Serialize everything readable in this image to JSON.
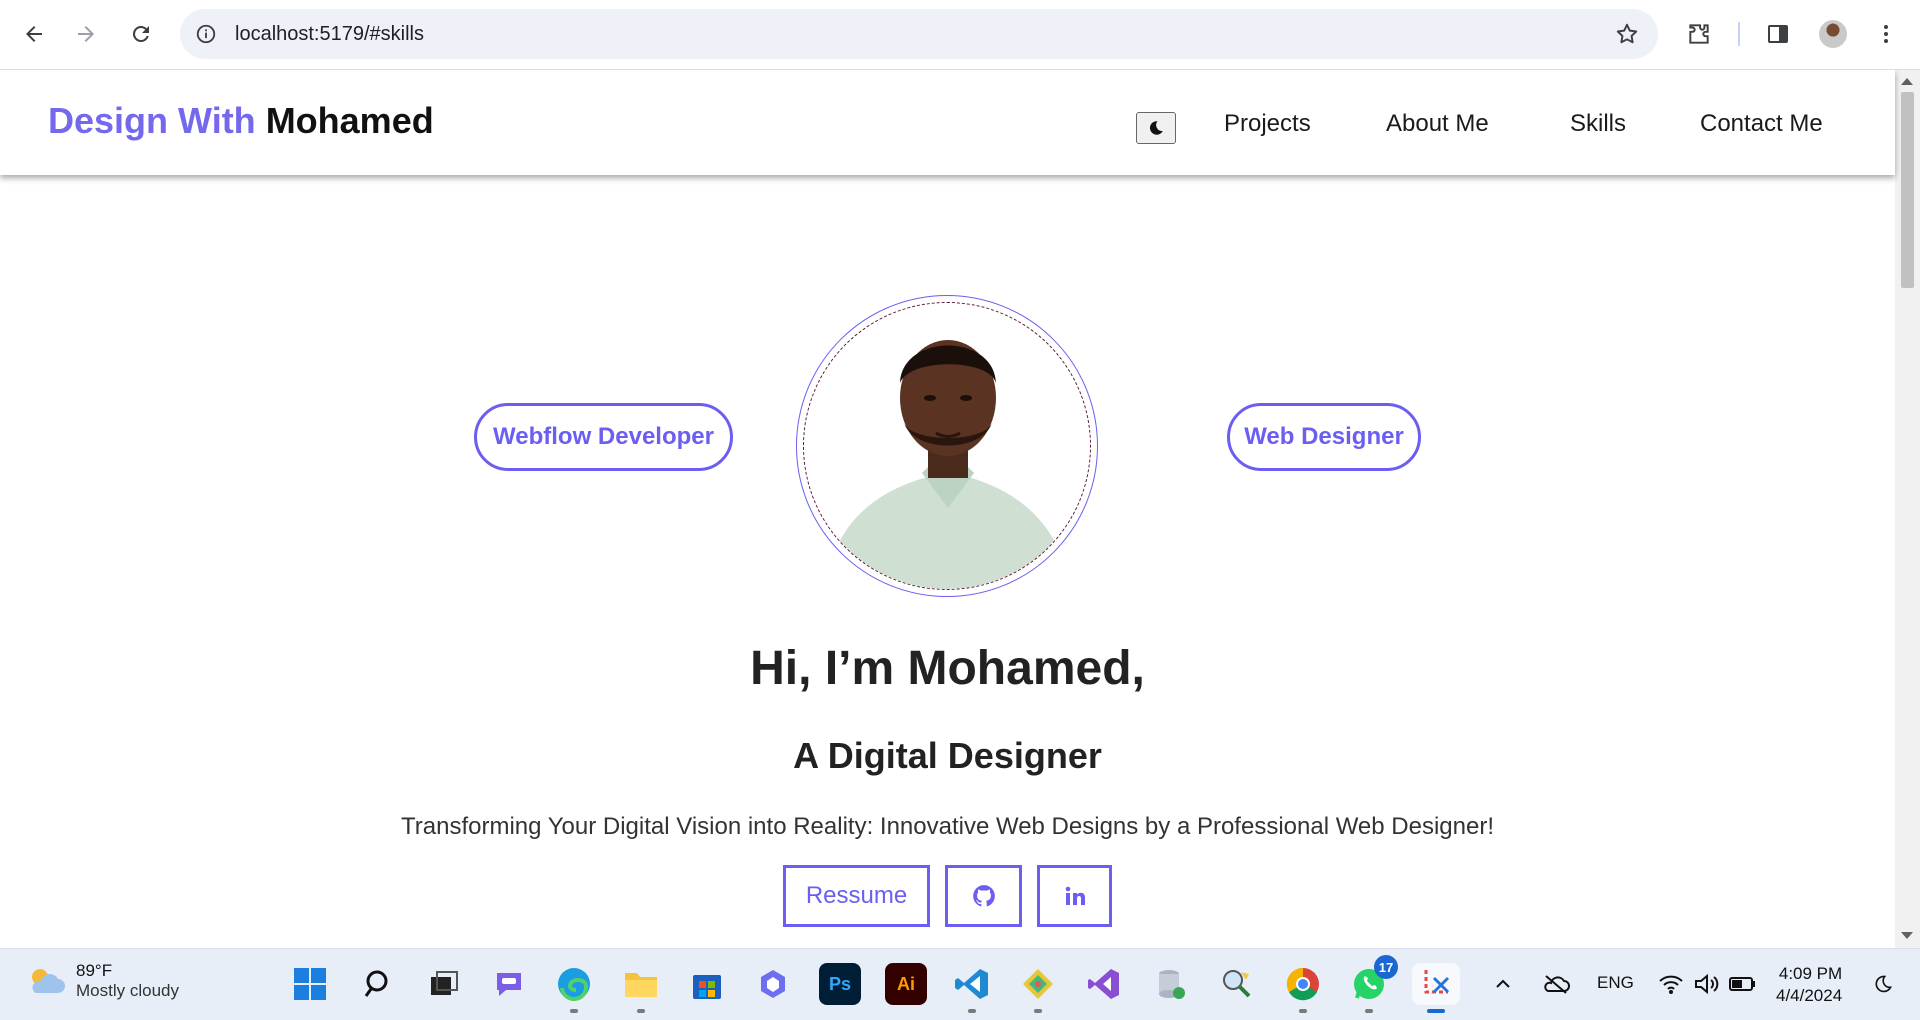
{
  "browser": {
    "url": "localhost:5179/#skills"
  },
  "site": {
    "logo_accent": "Design With",
    "logo_name": "Mohamed",
    "nav": [
      "Projects",
      "About Me",
      "Skills",
      "Contact Me"
    ],
    "accent_color": "#6b5ef0"
  },
  "hero": {
    "left_pill": "Webflow Developer",
    "right_pill": "Web Designer",
    "heading": "Hi, I’m Mohamed,",
    "subheading": "A Digital Designer",
    "tagline": "Transforming Your Digital Vision into Reality: Innovative Web Designs by a Professional Web Designer!",
    "resume_label": "Ressume"
  },
  "taskbar": {
    "temperature": "89°F",
    "condition": "Mostly cloudy",
    "whatsapp_badge": "17",
    "language": "ENG",
    "time": "4:09 PM",
    "date": "4/4/2024"
  }
}
